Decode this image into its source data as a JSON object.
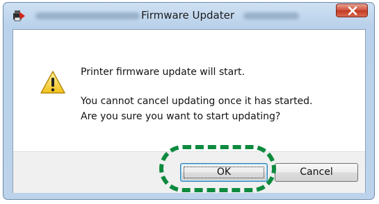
{
  "window": {
    "title": "Firmware Updater",
    "icon": "printer-app-icon",
    "close_icon": "close-x-icon"
  },
  "message": {
    "icon": "warning-icon",
    "line1": "Printer firmware update will start.",
    "line2": "You cannot cancel updating once it has started.",
    "line3": "Are you sure you want to start updating?"
  },
  "buttons": {
    "ok": "OK",
    "cancel": "Cancel"
  },
  "colors": {
    "highlight": "#0d8a3e",
    "close_button": "#c23a23",
    "titlebar": "#bcd3eb"
  }
}
